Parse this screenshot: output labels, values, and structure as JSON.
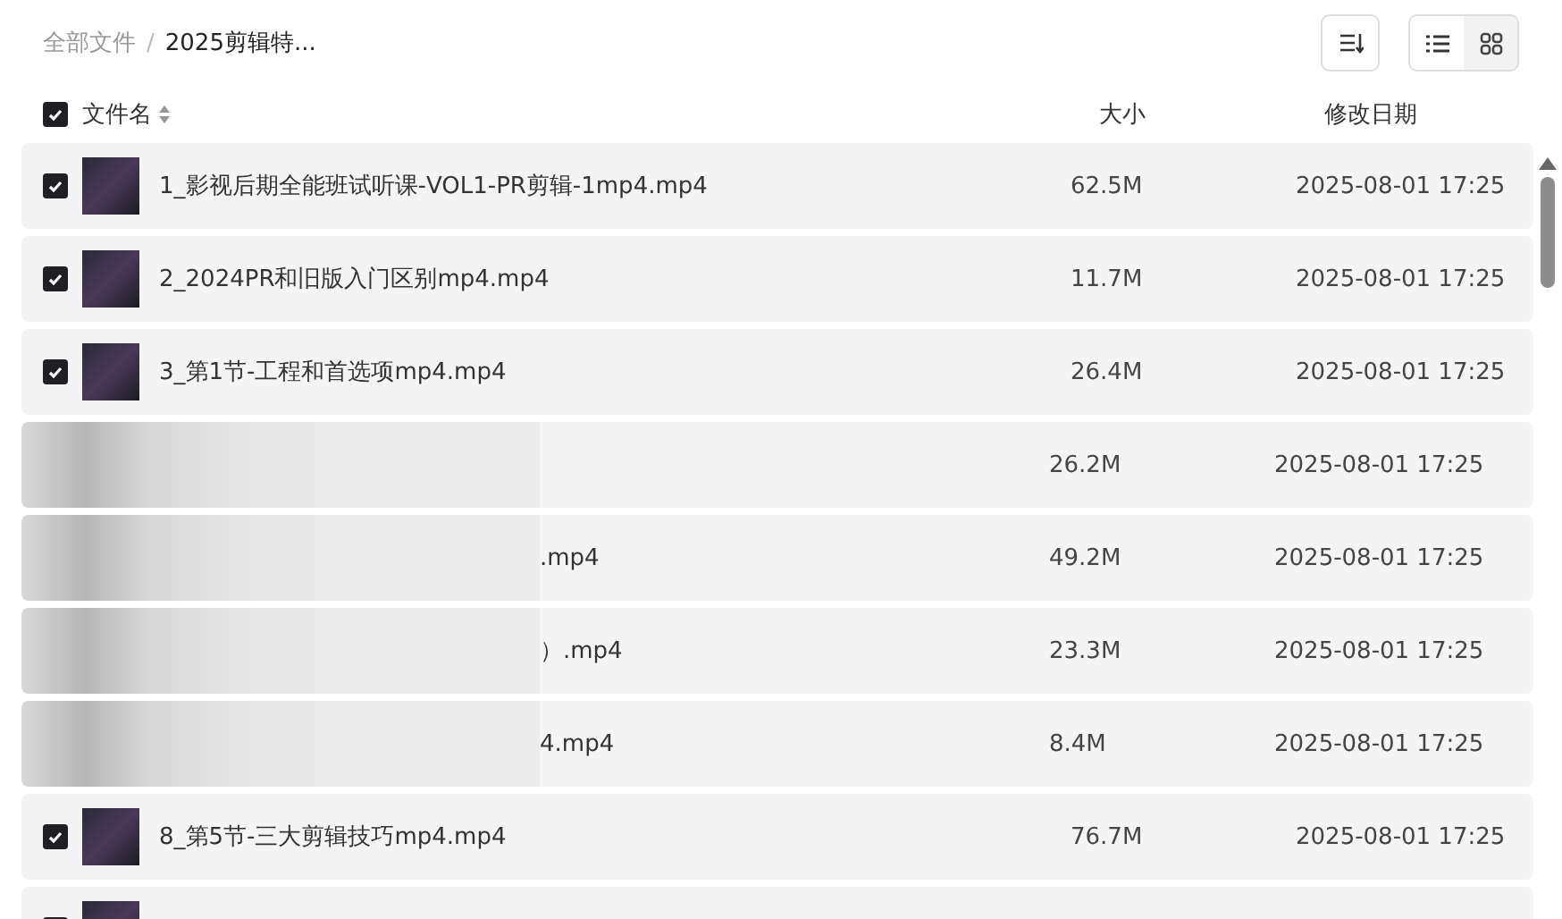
{
  "breadcrumb": [
    {
      "label": "全部文件",
      "current": false
    },
    {
      "label": "2025剪辑特...",
      "current": true
    }
  ],
  "breadcrumb_separator": "/",
  "toolbar": {
    "view_modes": [
      {
        "kind": "list",
        "selected": true
      },
      {
        "kind": "grid",
        "selected": false
      }
    ]
  },
  "table": {
    "select_all": {
      "checked": true
    },
    "columns": [
      "文件名",
      "大小",
      "修改日期"
    ],
    "rows": [
      {
        "kind": "file",
        "checked": true,
        "name": "1_影视后期全能班试听课-VOL1-PR剪辑-1mp4.mp4",
        "size": "62.5M",
        "modified": "2025-08-01 17:25"
      },
      {
        "kind": "file",
        "checked": true,
        "name": "2_2024PR和旧版入门区别mp4.mp4",
        "size": "11.7M",
        "modified": "2025-08-01 17:25"
      },
      {
        "kind": "file",
        "checked": true,
        "name": "3_第1节-工程和首选项mp4.mp4",
        "size": "26.4M",
        "modified": "2025-08-01 17:25"
      },
      {
        "kind": "obscured",
        "size": "26.2M",
        "modified": "2025-08-01 17:25"
      },
      {
        "kind": "obscured",
        "name": ".mp4",
        "size": "49.2M",
        "modified": "2025-08-01 17:25"
      },
      {
        "kind": "obscured",
        "name": "）.mp4",
        "size": "23.3M",
        "modified": "2025-08-01 17:25"
      },
      {
        "kind": "obscured",
        "name": "4.mp4",
        "size": "8.4M",
        "modified": "2025-08-01 17:25"
      },
      {
        "kind": "file",
        "checked": true,
        "name": "8_第5节-三大剪辑技巧mp4.mp4",
        "size": "76.7M",
        "modified": "2025-08-01 17:25"
      },
      {
        "kind": "file",
        "checked": true
      }
    ]
  }
}
